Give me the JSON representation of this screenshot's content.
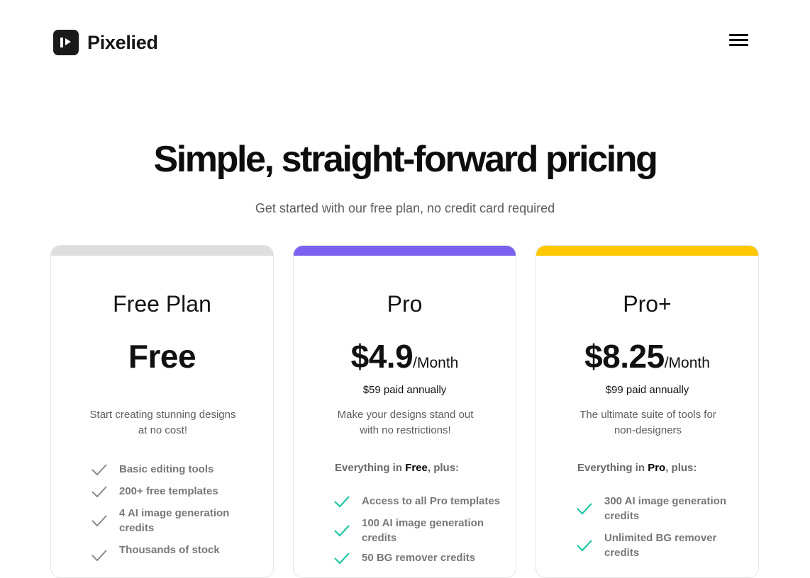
{
  "header": {
    "brand": "Pixelied",
    "logo_icon": "pixelied-logo-icon",
    "menu_icon": "hamburger-menu-icon"
  },
  "hero": {
    "title": "Simple, straight-forward pricing",
    "subtitle": "Get started with our free plan, no credit card required"
  },
  "colors": {
    "free_bar": "#dedede",
    "pro_bar": "#7b61f0",
    "proplus_bar": "#ffc800",
    "check_free": "#8a8a8a",
    "check_paid": "#1ec7a4"
  },
  "plans": [
    {
      "name": "Free Plan",
      "price": "Free",
      "unit": "",
      "billed": "",
      "description_line1": "Start creating stunning designs",
      "description_line2": "at no cost!",
      "includes_prefix": "",
      "includes_bold": "",
      "includes_suffix": "",
      "features": [
        {
          "line1": "Basic editing tools",
          "line2": ""
        },
        {
          "line1": "200+ free templates",
          "line2": ""
        },
        {
          "line1": "4 AI image generation",
          "line2": "credits"
        },
        {
          "line1": "Thousands of stock",
          "line2": ""
        }
      ]
    },
    {
      "name": "Pro",
      "price": "$4.9",
      "unit": "/Month",
      "billed": "$59 paid annually",
      "description_line1": "Make your designs stand out",
      "description_line2": "with no restrictions!",
      "includes_prefix": "Everything in ",
      "includes_bold": "Free",
      "includes_suffix": ", plus:",
      "features": [
        {
          "line1": "Access to all Pro templates",
          "line2": ""
        },
        {
          "line1": "100 AI image generation",
          "line2": "credits"
        },
        {
          "line1": "50 BG remover credits",
          "line2": ""
        }
      ]
    },
    {
      "name": "Pro+",
      "price": "$8.25",
      "unit": "/Month",
      "billed": "$99 paid annually",
      "description_line1": "The ultimate suite of tools for",
      "description_line2": "non-designers",
      "includes_prefix": "Everything in ",
      "includes_bold": "Pro",
      "includes_suffix": ", plus:",
      "features": [
        {
          "line1": "300 AI image generation",
          "line2": "credits"
        },
        {
          "line1": "Unlimited BG remover",
          "line2": "credits"
        }
      ]
    }
  ]
}
